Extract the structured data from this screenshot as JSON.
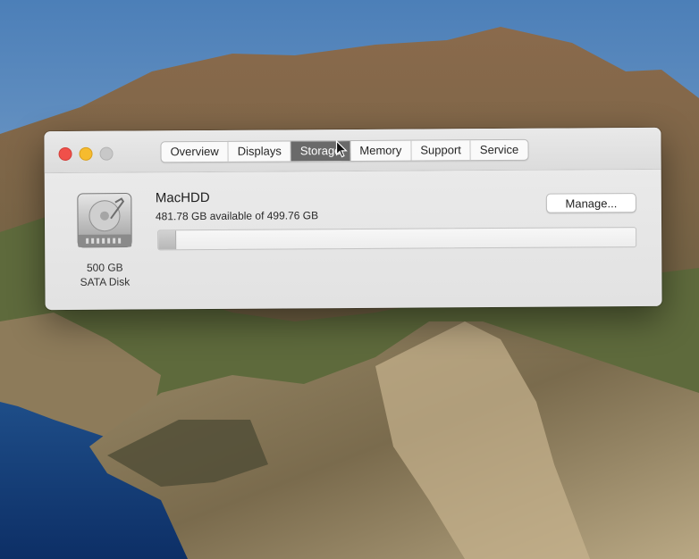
{
  "window": {
    "tabs": [
      {
        "label": "Overview",
        "selected": false
      },
      {
        "label": "Displays",
        "selected": false
      },
      {
        "label": "Storage",
        "selected": true
      },
      {
        "label": "Memory",
        "selected": false
      },
      {
        "label": "Support",
        "selected": false
      },
      {
        "label": "Service",
        "selected": false
      }
    ]
  },
  "storage": {
    "disk_size": "500 GB",
    "disk_type": "SATA Disk",
    "volume_name": "MacHDD",
    "availability": "481.78 GB available of 499.76 GB",
    "used_fraction": 0.036,
    "manage_label": "Manage..."
  },
  "colors": {
    "close": "#f0504a",
    "minimize": "#f6bb2e",
    "maximize": "#c8c8c8",
    "selected_tab": "#6a6a6a"
  }
}
